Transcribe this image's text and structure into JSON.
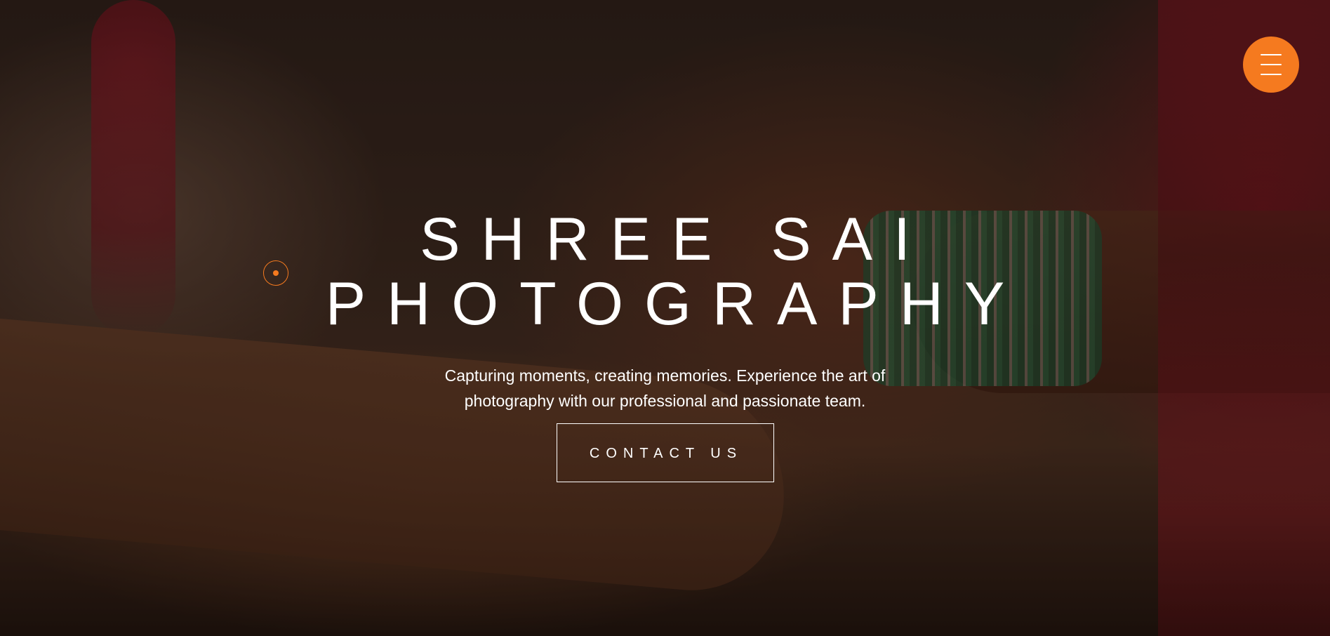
{
  "hero": {
    "title_line1": "SHREE SAI",
    "title_line2": "PHOTOGRAPHY",
    "subtitle": "Capturing moments, creating memories. Experience the art of photography with our professional and passionate team.",
    "cta_label": "CONTACT US"
  },
  "menu": {
    "icon": "hamburger-menu-icon",
    "color": "#f57a1f"
  },
  "accent_color": "#f57a1f"
}
